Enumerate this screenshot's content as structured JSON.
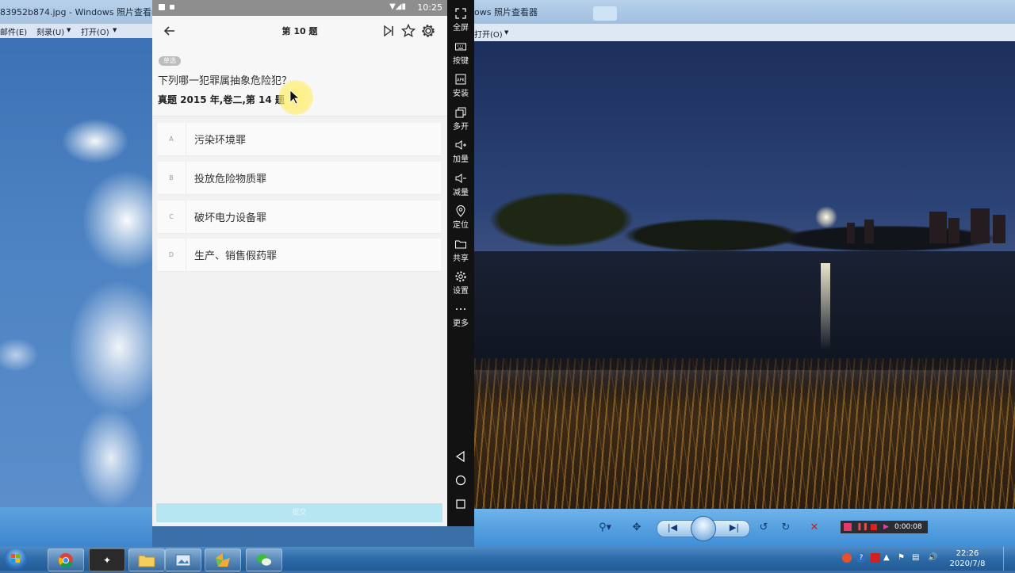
{
  "left_viewer": {
    "title": "83952b874.jpg - Windows 照片查看器",
    "menu": [
      "邮件(E)",
      "刻录(U)",
      "打开(O)"
    ]
  },
  "right_viewer": {
    "title": "ows 照片查看器",
    "menu_open": "打开(O)",
    "recorder_time": "0:00:08"
  },
  "phone": {
    "status_time": "10:25",
    "appbar_title": "第 10 题",
    "question": {
      "badge": "单选",
      "text": "下列哪一犯罪属抽象危险犯？",
      "source": "真题 2015 年,卷二,第 14 题"
    },
    "options": [
      {
        "letter": "A",
        "text": "污染环境罪"
      },
      {
        "letter": "B",
        "text": "投放危险物质罪"
      },
      {
        "letter": "C",
        "text": "破坏电力设备罪"
      },
      {
        "letter": "D",
        "text": "生产、销售假药罪"
      }
    ],
    "submit_label": "提交"
  },
  "sidebar": {
    "items": [
      {
        "label": "全屏",
        "icon": "fullscreen-icon"
      },
      {
        "label": "按键",
        "icon": "keyboard-icon"
      },
      {
        "label": "安装",
        "icon": "apk-install-icon"
      },
      {
        "label": "多开",
        "icon": "multi-instance-icon"
      },
      {
        "label": "加量",
        "icon": "volume-up-icon"
      },
      {
        "label": "减量",
        "icon": "volume-down-icon"
      },
      {
        "label": "定位",
        "icon": "location-icon"
      },
      {
        "label": "共享",
        "icon": "folder-icon"
      },
      {
        "label": "设置",
        "icon": "gear-icon"
      },
      {
        "label": "更多",
        "icon": "more-icon"
      }
    ]
  },
  "taskbar": {
    "clock_time": "22:26",
    "clock_date": "2020/7/8"
  }
}
